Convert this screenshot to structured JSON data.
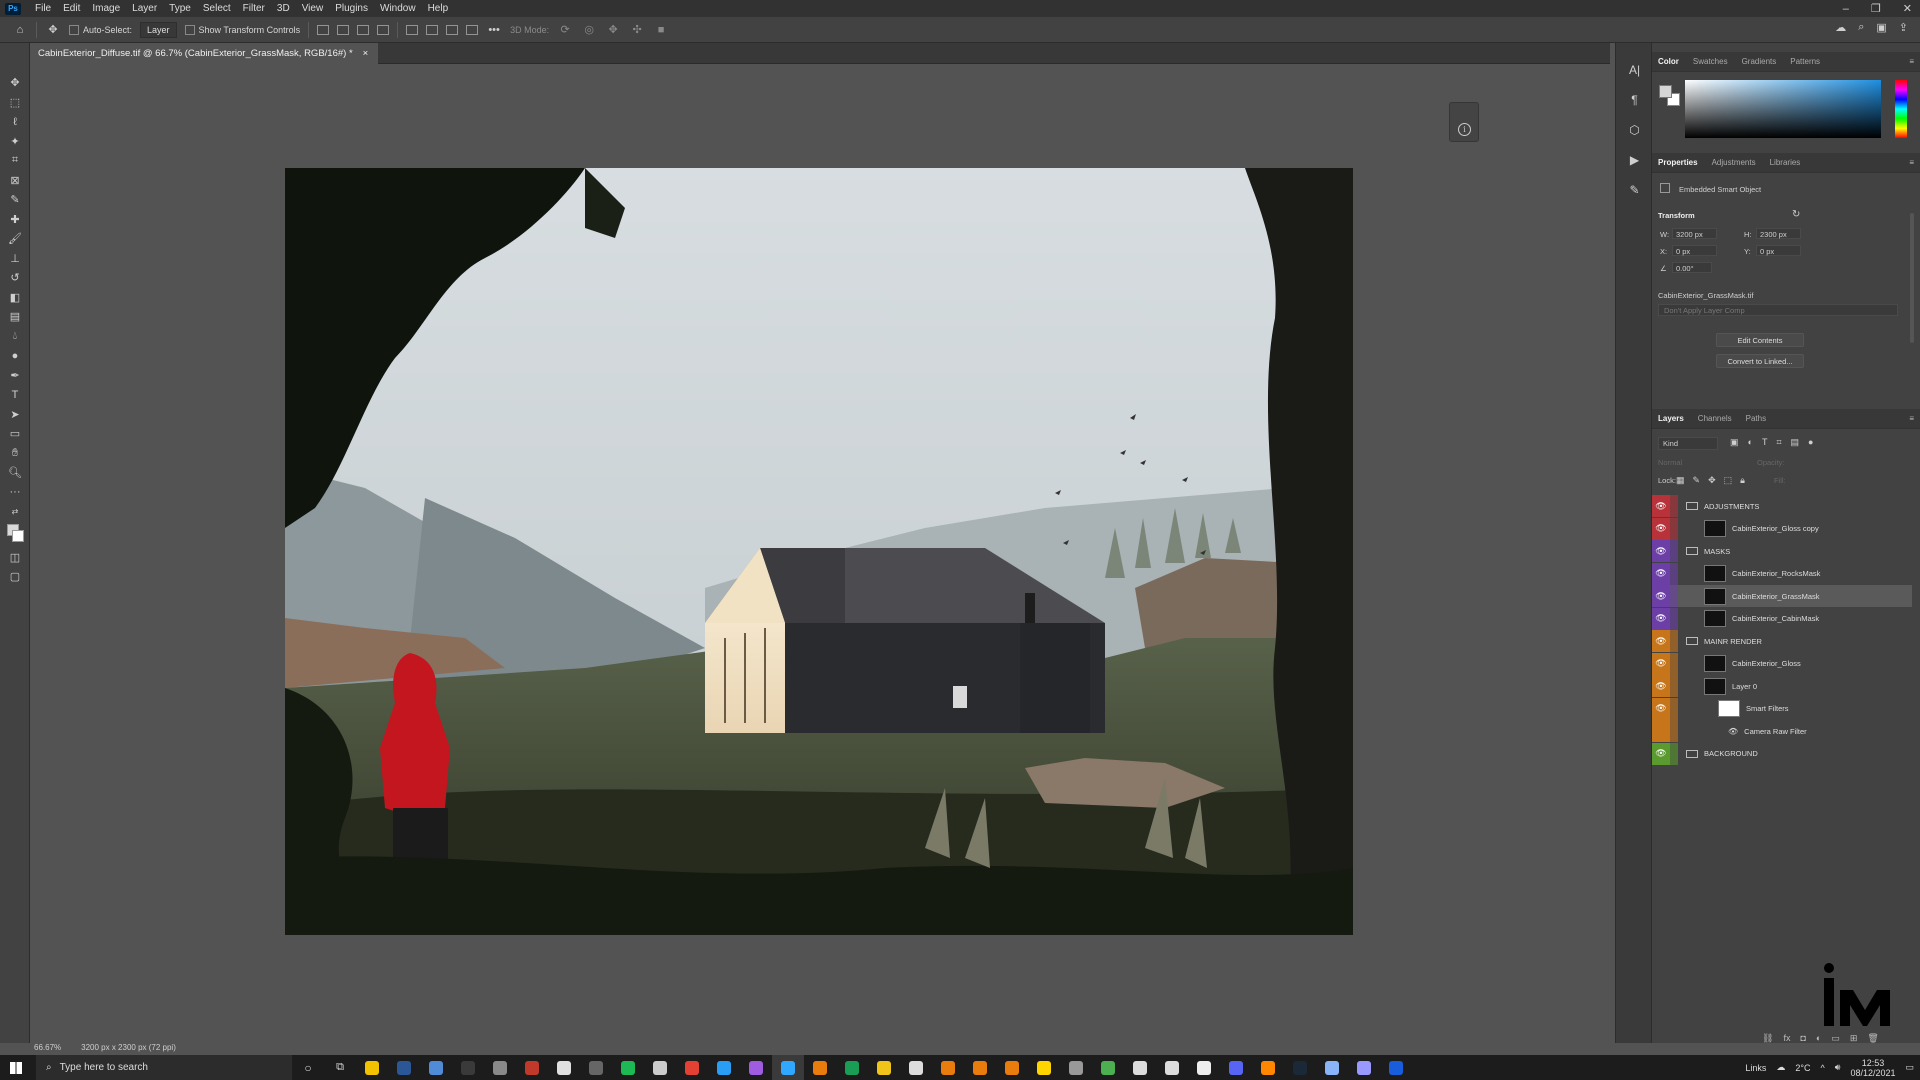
{
  "menu": [
    "File",
    "Edit",
    "Image",
    "Layer",
    "Type",
    "Select",
    "Filter",
    "3D",
    "View",
    "Plugins",
    "Window",
    "Help"
  ],
  "options": {
    "auto_select_label": "Auto-Select:",
    "auto_select_value": "Layer",
    "transform_controls_label": "Show Transform Controls",
    "mode_label": "3D Mode:"
  },
  "document": {
    "tab_title": "CabinExterior_Diffuse.tif @ 66.7% (CabinExterior_GrassMask, RGB/16#) *",
    "close": "×"
  },
  "status": {
    "zoom": "66.67%",
    "doc_info": "3200 px x 2300 px (72 ppi)"
  },
  "color_panel": {
    "tabs": [
      "Color",
      "Swatches",
      "Gradients",
      "Patterns"
    ]
  },
  "properties_panel": {
    "tabs": [
      "Properties",
      "Adjustments",
      "Libraries"
    ],
    "object_type": "Embedded Smart Object",
    "transform_title": "Transform",
    "w_label": "W:",
    "w_value": "3200 px",
    "h_label": "H:",
    "h_value": "2300 px",
    "x_label": "X:",
    "x_value": "0 px",
    "y_label": "Y:",
    "y_value": "0 px",
    "angle_value": "0.00°",
    "filename": "CabinExterior_GrassMask.tif",
    "layer_comp_placeholder": "Don't Apply Layer Comp",
    "edit_contents": "Edit Contents",
    "convert_linked": "Convert to Linked..."
  },
  "layers_panel": {
    "tabs": [
      "Layers",
      "Channels",
      "Paths"
    ],
    "kind": "Kind",
    "blend_mode": "Normal",
    "opacity_label": "Opacity:",
    "lock_label": "Lock:",
    "fill_label": "Fill:",
    "layers": [
      {
        "name": "ADJUSTMENTS",
        "type": "group",
        "color": "#b8323a"
      },
      {
        "name": "CabinExterior_Gloss copy",
        "type": "layer",
        "color": "#b8323a"
      },
      {
        "name": "MASKS",
        "type": "group",
        "color": "#6b3fa6"
      },
      {
        "name": "CabinExterior_RocksMask",
        "type": "layer",
        "color": "#6b3fa6"
      },
      {
        "name": "CabinExterior_GrassMask",
        "type": "layer",
        "color": "#6b3fa6",
        "selected": true
      },
      {
        "name": "CabinExterior_CabinMask",
        "type": "layer",
        "color": "#6b3fa6"
      },
      {
        "name": "MAINR RENDER",
        "type": "group",
        "color": "#c7751a"
      },
      {
        "name": "CabinExterior_Gloss",
        "type": "layer",
        "color": "#c7751a"
      },
      {
        "name": "Layer 0",
        "type": "layer",
        "color": "#c7751a"
      },
      {
        "name": "Smart Filters",
        "type": "filter",
        "color": "#c7751a"
      },
      {
        "name": "Camera Raw Filter",
        "type": "subfilter",
        "color": "#c7751a"
      },
      {
        "name": "BACKGROUND",
        "type": "group",
        "color": "#5a9a2f"
      }
    ]
  },
  "taskbar": {
    "search_placeholder": "Type here to search",
    "links": "Links",
    "temp": "2°C",
    "time": "12:53",
    "date": "08/12/2021",
    "apps": [
      "explorer",
      "word",
      "calc",
      "store",
      "files",
      "tool",
      "app",
      "chrome-like",
      "spotify",
      "nl",
      "chrome",
      "edge",
      "aff",
      "photoshop",
      "blender",
      "sheets",
      "m",
      "gamepad",
      "blender2",
      "blender3",
      "blender4",
      "sticky",
      "davinci",
      "git",
      "unreal",
      "unreal2",
      "screen",
      "discord",
      "vlc",
      "steam",
      "drive",
      "premiere",
      "bitwarden"
    ]
  }
}
